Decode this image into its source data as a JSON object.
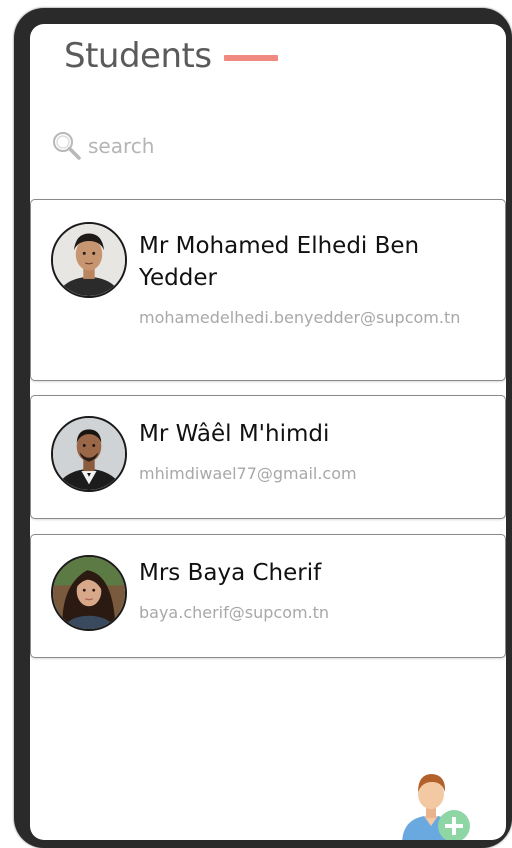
{
  "header": {
    "title": "Students"
  },
  "search": {
    "placeholder": "search",
    "value": ""
  },
  "students": [
    {
      "name": "Mr Mohamed Elhedi Ben Yedder",
      "email": "mohamedelhedi.benyedder@supcom.tn"
    },
    {
      "name": "Mr Wâêl M'himdi",
      "email": "mhimdiwael77@gmail.com"
    },
    {
      "name": "Mrs Baya Cherif",
      "email": "baya.cherif@supcom.tn"
    }
  ],
  "icons": {
    "search": "search-icon",
    "add_student": "add-user-icon"
  },
  "colors": {
    "title_accent": "#f08a80",
    "title_text": "#5a5a5a",
    "email_text": "#a8a8a8",
    "fab_plus": "#8fd6a5",
    "fab_person": "#6aa8e0"
  }
}
